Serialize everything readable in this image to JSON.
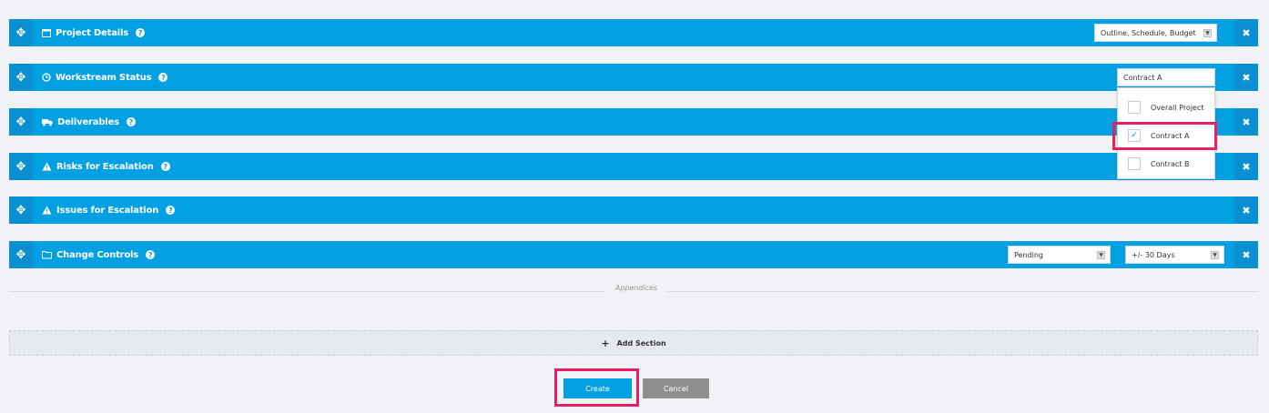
{
  "sections": [
    {
      "title": "Project Details",
      "icon": "calendar-icon",
      "select": "Outline, Schedule, Budget"
    },
    {
      "title": "Workstream Status",
      "icon": "clock-icon",
      "select": "Contract A"
    },
    {
      "title": "Deliverables",
      "icon": "truck-icon"
    },
    {
      "title": "Risks for Escalation",
      "icon": "warning-icon"
    },
    {
      "title": "Issues for Escalation",
      "icon": "warning-icon"
    },
    {
      "title": "Change Controls",
      "icon": "folder-icon",
      "select_status": "Pending",
      "select_range": "+/- 30 Days"
    }
  ],
  "dropdown": {
    "options": [
      {
        "label": "Overall Project",
        "checked": false
      },
      {
        "label": "Contract A",
        "checked": true
      },
      {
        "label": "Contract B",
        "checked": false
      }
    ]
  },
  "appendices_label": "Appendices",
  "add_section_label": "Add Section",
  "buttons": {
    "create": "Create",
    "cancel": "Cancel"
  },
  "colors": {
    "section_bg": "#00a0e3",
    "highlight": "#e91e63",
    "cancel_bg": "#8e8e8e"
  }
}
